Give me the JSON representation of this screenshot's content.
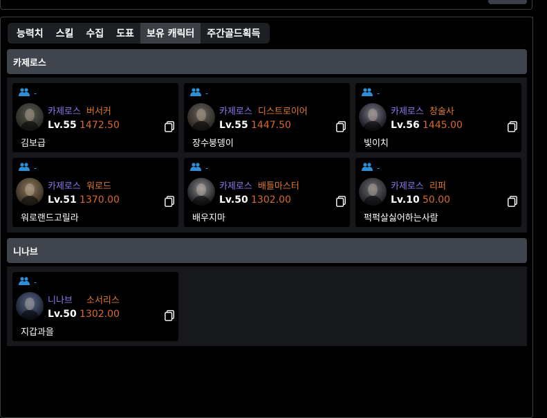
{
  "tabs": [
    {
      "label": "능력치",
      "active": false
    },
    {
      "label": "스킬",
      "active": false
    },
    {
      "label": "수집",
      "active": false
    },
    {
      "label": "도표",
      "active": false
    },
    {
      "label": "보유 캐릭터",
      "active": true
    },
    {
      "label": "주간골드획득",
      "active": false
    }
  ],
  "sections": [
    {
      "title": "카제로스",
      "characters": [
        {
          "party": "-",
          "server": "카제로스",
          "class": "버서커",
          "level": "Lv.55",
          "item_level": "1472.50",
          "name": "김보급",
          "icon": "person-pair-icon"
        },
        {
          "party": "-",
          "server": "카제로스",
          "class": "디스트로이어",
          "level": "Lv.55",
          "item_level": "1447.50",
          "name": "장수붕뎅이",
          "icon": "person-pair-icon"
        },
        {
          "party": "-",
          "server": "카제로스",
          "class": "창술사",
          "level": "Lv.56",
          "item_level": "1445.00",
          "name": "빛이치",
          "icon": "person-pair-icon"
        },
        {
          "party": "-",
          "server": "카제로스",
          "class": "워로드",
          "level": "Lv.51",
          "item_level": "1370.00",
          "name": "워로랜드고릴라",
          "icon": "person-pair-icon"
        },
        {
          "party": "-",
          "server": "카제로스",
          "class": "배틀마스터",
          "level": "Lv.50",
          "item_level": "1302.00",
          "name": "배우지마",
          "icon": "person-pair-icon"
        },
        {
          "party": "-",
          "server": "카제로스",
          "class": "리퍼",
          "level": "Lv.10",
          "item_level": "50.00",
          "name": "퍽퍽살싫어하는사람",
          "icon": "person-pair-icon"
        }
      ]
    },
    {
      "title": "니나브",
      "characters": [
        {
          "party": "-",
          "server": "니나브",
          "class": "소서리스",
          "level": "Lv.50",
          "item_level": "1302.00",
          "name": "지갑과을",
          "icon": "person-pair-icon"
        }
      ]
    }
  ],
  "colors": {
    "server": "#8e7cf2",
    "class": "#e07a2e",
    "item_level": "#d86a2a",
    "party_icon": "#2f8fd6",
    "section_header": "#40444c"
  }
}
